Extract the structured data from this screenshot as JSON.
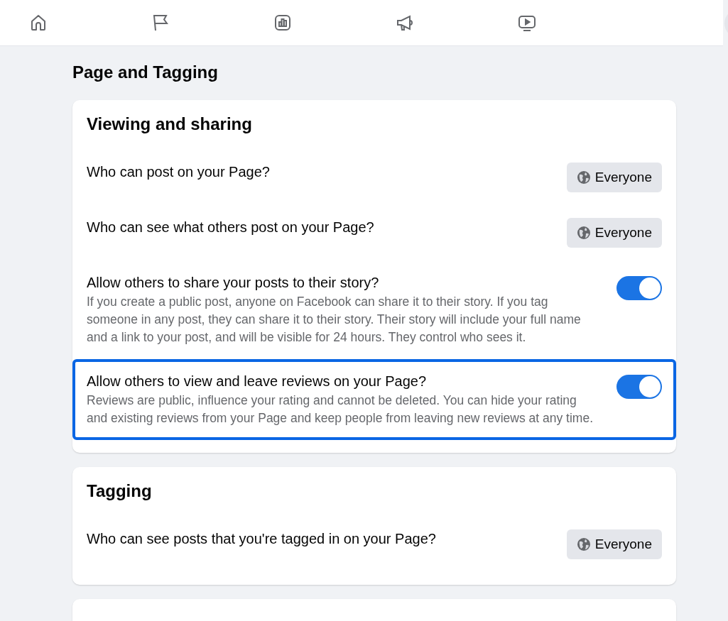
{
  "nav": {
    "items": [
      {
        "kind": "home",
        "selected": false
      },
      {
        "kind": "flag",
        "selected": false
      },
      {
        "kind": "chart",
        "selected": false
      },
      {
        "kind": "megaphone",
        "selected": false
      },
      {
        "kind": "video",
        "selected": false
      }
    ]
  },
  "page_title": "Page and Tagging",
  "sections": [
    {
      "heading": "Viewing and sharing",
      "rows": [
        {
          "kind": "select",
          "label": "Who can post on your Page?",
          "value": "Everyone",
          "highlighted": false
        },
        {
          "kind": "select",
          "label": "Who can see what others post on your Page?",
          "value": "Everyone",
          "highlighted": false
        },
        {
          "kind": "toggle",
          "label": "Allow others to share your posts to their story?",
          "description": "If you create a public post, anyone on Facebook can share it to their story. If you tag someone in any post, they can share it to their story. Their story will include your full name and a link to your post, and will be visible for 24 hours. They control who sees it.",
          "on": true,
          "highlighted": false
        },
        {
          "kind": "toggle",
          "label": "Allow others to view and leave reviews on your Page?",
          "description": "Reviews are public, influence your rating and cannot be deleted. You can hide your rating and existing reviews from your Page and keep people from leaving new reviews at any time.",
          "on": true,
          "highlighted": true
        }
      ]
    },
    {
      "heading": "Tagging",
      "rows": [
        {
          "kind": "select",
          "label": "Who can see posts that you're tagged in on your Page?",
          "value": "Everyone",
          "highlighted": false
        }
      ]
    }
  ]
}
